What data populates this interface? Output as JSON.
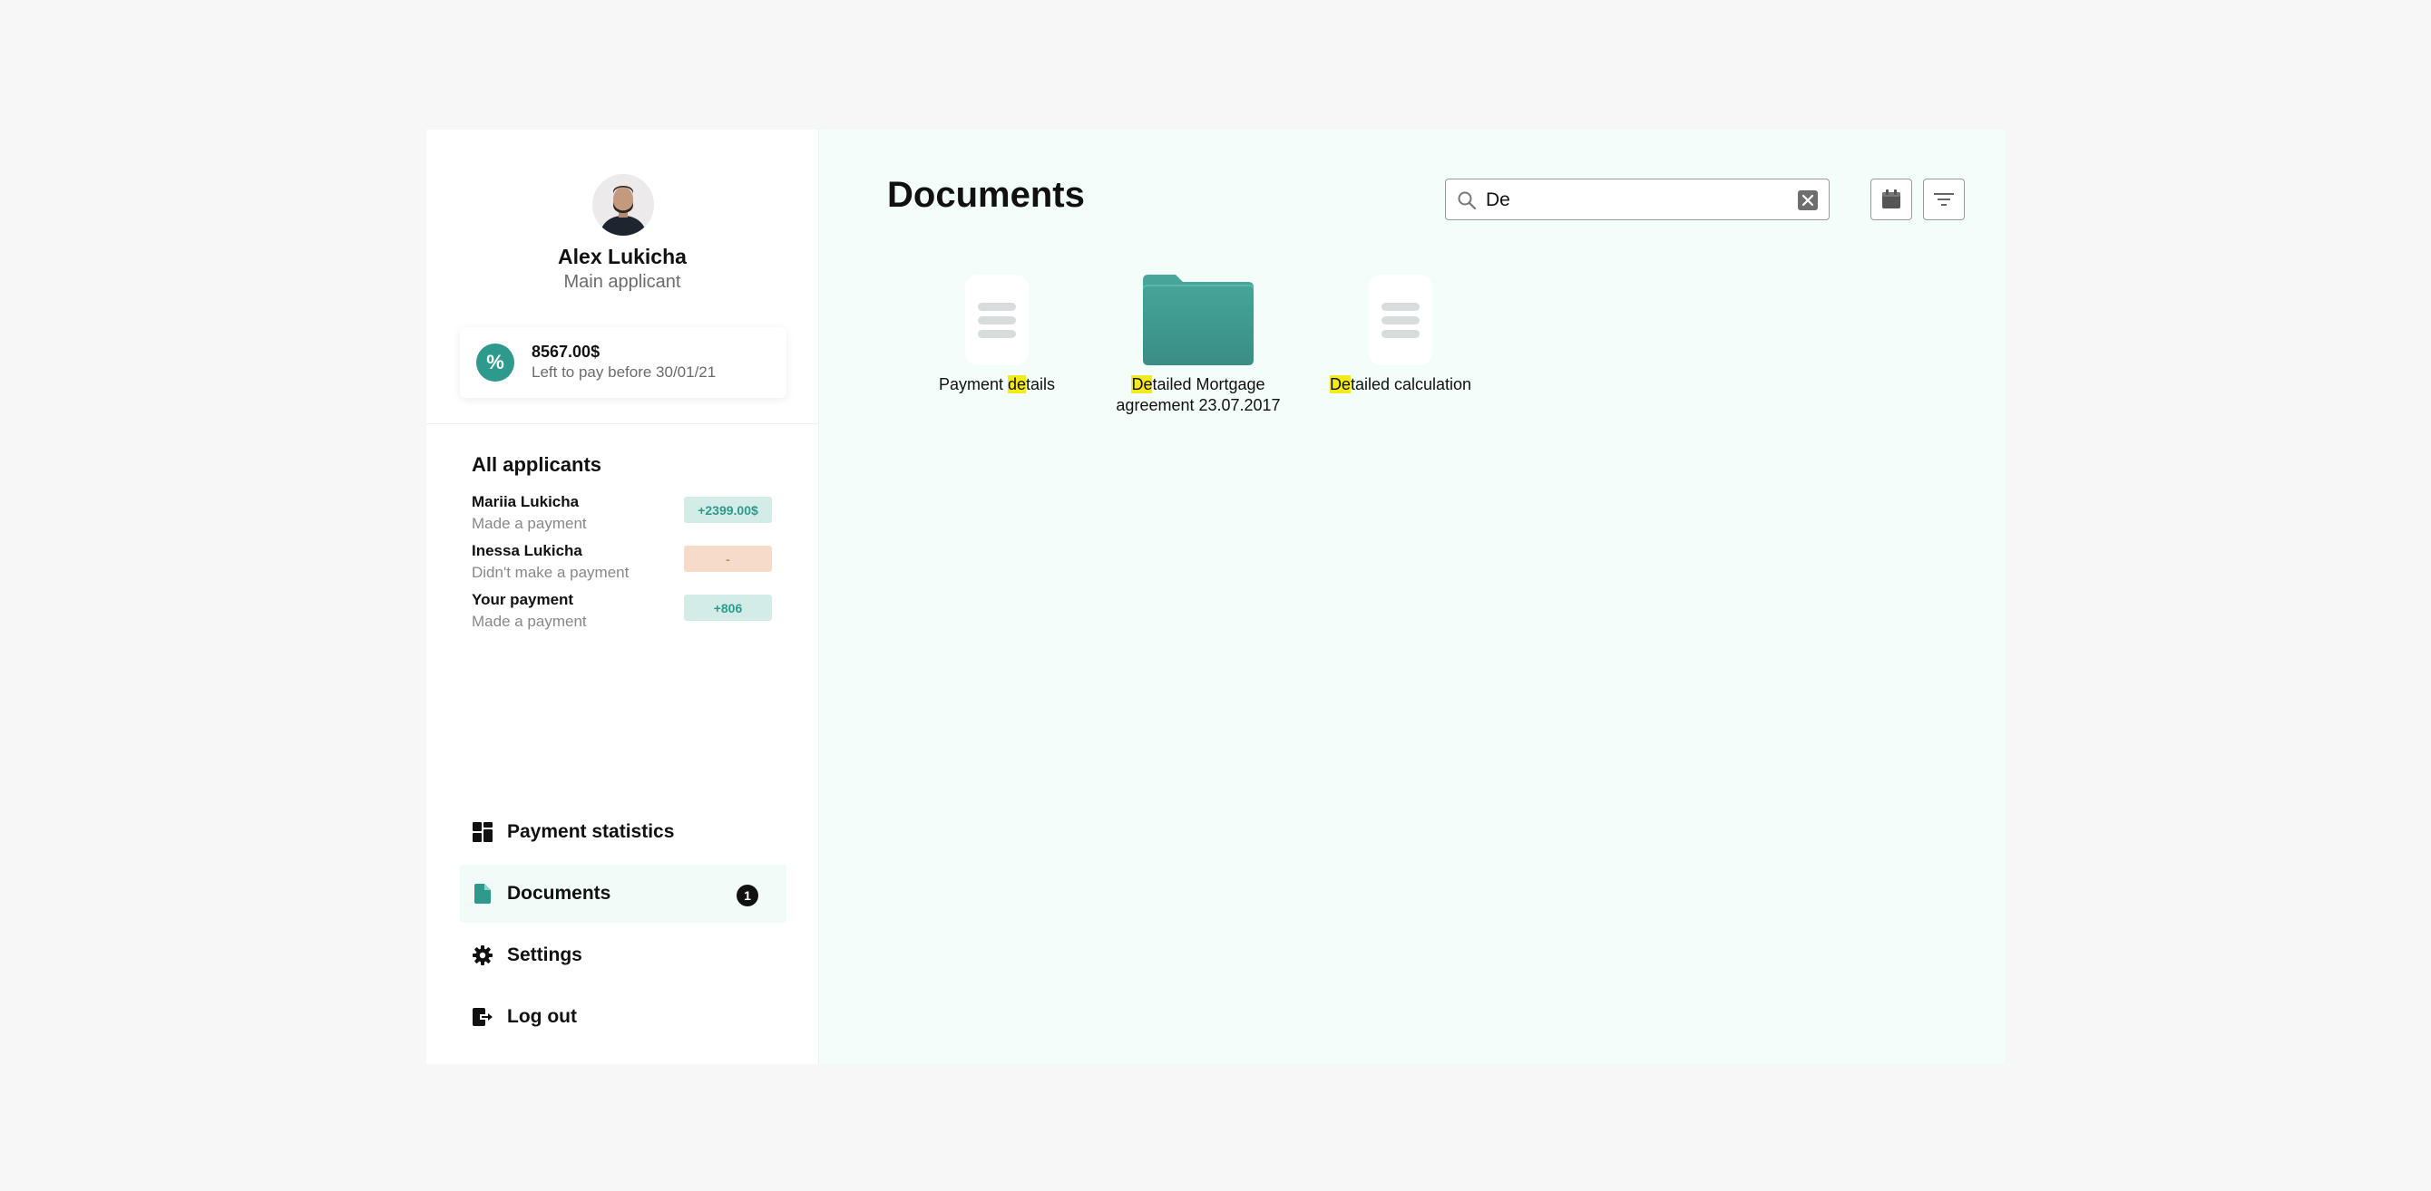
{
  "user": {
    "name": "Alex Lukicha",
    "role": "Main applicant"
  },
  "payment_card": {
    "icon": "percent-icon",
    "icon_text": "%",
    "amount": "8567.00$",
    "subtitle": "Left to pay before 30/01/21"
  },
  "applicants": {
    "title": "All applicants",
    "items": [
      {
        "name": "Mariia Lukicha",
        "status": "Made a payment",
        "badge": "+2399.00$",
        "badge_color": "#d3ece8"
      },
      {
        "name": "Inessa Lukicha",
        "status": "Didn't make a payment",
        "badge": "-",
        "badge_color": "#f6dcc8"
      },
      {
        "name": "Your payment",
        "status": "Made a payment",
        "badge": "+806",
        "badge_color": "#d3ece8"
      }
    ]
  },
  "nav": {
    "items": [
      {
        "label": "Payment statistics",
        "icon": "dashboard-icon"
      },
      {
        "label": "Documents",
        "icon": "document-icon",
        "count": "1",
        "active": true
      },
      {
        "label": "Settings",
        "icon": "gear-icon"
      },
      {
        "label": "Log out",
        "icon": "logout-icon"
      }
    ]
  },
  "main": {
    "title": "Documents",
    "search": {
      "value": "De",
      "placeholder": ""
    },
    "documents": [
      {
        "type": "file",
        "pre": "Payment ",
        "match": "de",
        "post": "tails"
      },
      {
        "type": "folder",
        "pre": "",
        "match": "De",
        "post": "tailed Mortgage agreement 23.07.2017"
      },
      {
        "type": "file",
        "pre": "",
        "match": "De",
        "post": "tailed calculation"
      }
    ]
  },
  "colors": {
    "accent": "#2e9a8e",
    "highlight": "#f5e91c",
    "main_bg": "#f3fdfa"
  }
}
